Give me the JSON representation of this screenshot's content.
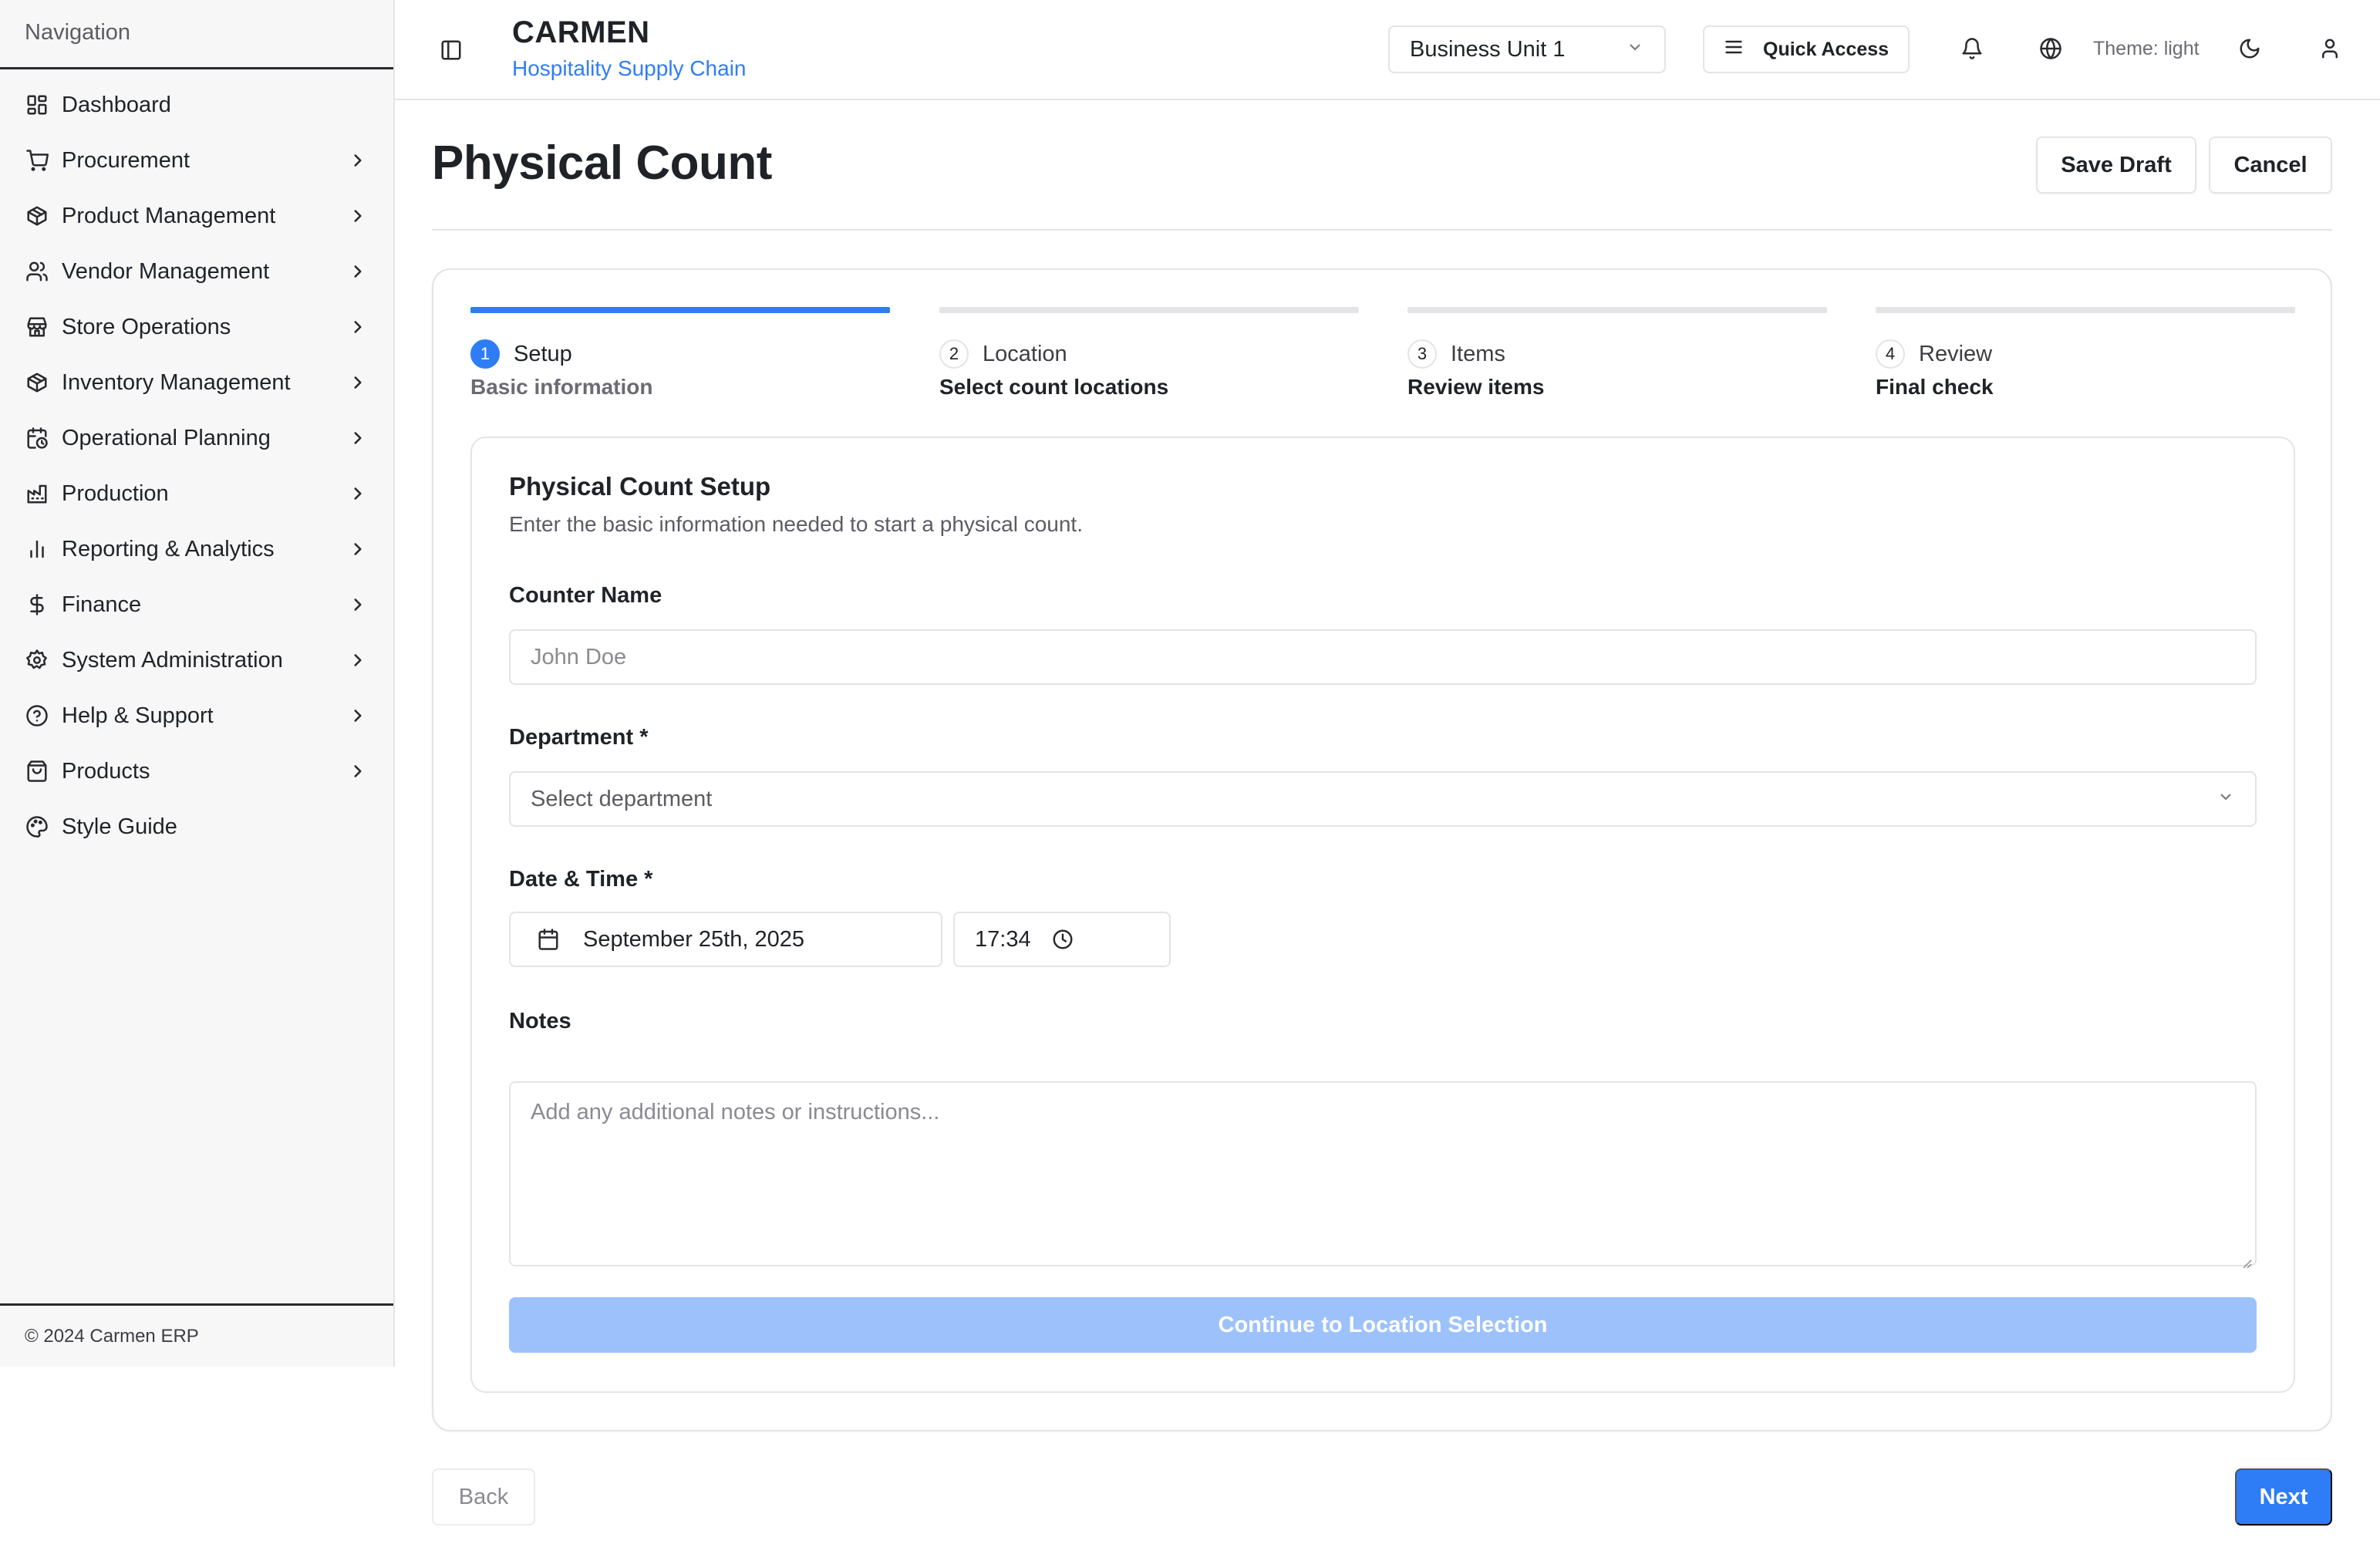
{
  "sidebar": {
    "heading": "Navigation",
    "items": [
      {
        "label": "Dashboard",
        "icon": "dashboard-icon",
        "has_children": false
      },
      {
        "label": "Procurement",
        "icon": "cart-icon",
        "has_children": true
      },
      {
        "label": "Product Management",
        "icon": "package-icon",
        "has_children": true
      },
      {
        "label": "Vendor Management",
        "icon": "users-icon",
        "has_children": true
      },
      {
        "label": "Store Operations",
        "icon": "store-icon",
        "has_children": true
      },
      {
        "label": "Inventory Management",
        "icon": "package-icon",
        "has_children": true
      },
      {
        "label": "Operational Planning",
        "icon": "calendar-clock-icon",
        "has_children": true
      },
      {
        "label": "Production",
        "icon": "factory-icon",
        "has_children": true
      },
      {
        "label": "Reporting & Analytics",
        "icon": "bar-chart-icon",
        "has_children": true
      },
      {
        "label": "Finance",
        "icon": "dollar-icon",
        "has_children": true
      },
      {
        "label": "System Administration",
        "icon": "settings-icon",
        "has_children": true
      },
      {
        "label": "Help & Support",
        "icon": "help-circle-icon",
        "has_children": true
      },
      {
        "label": "Products",
        "icon": "shopping-bag-icon",
        "has_children": true
      },
      {
        "label": "Style Guide",
        "icon": "palette-icon",
        "has_children": false
      }
    ],
    "footer": "© 2024 Carmen ERP"
  },
  "header": {
    "brand_name": "CARMEN",
    "brand_subtitle": "Hospitality Supply Chain",
    "business_unit": "Business Unit 1",
    "quick_access_label": "Quick Access",
    "theme_label": "Theme: light"
  },
  "page": {
    "title": "Physical Count",
    "save_draft_label": "Save Draft",
    "cancel_label": "Cancel"
  },
  "steps": [
    {
      "number": "1",
      "title": "Setup",
      "subtitle": "Basic information",
      "active": true
    },
    {
      "number": "2",
      "title": "Location",
      "subtitle": "Select count locations",
      "active": false
    },
    {
      "number": "3",
      "title": "Items",
      "subtitle": "Review items",
      "active": false
    },
    {
      "number": "4",
      "title": "Review",
      "subtitle": "Final check",
      "active": false
    }
  ],
  "form": {
    "title": "Physical Count Setup",
    "description": "Enter the basic information needed to start a physical count.",
    "counter_name_label": "Counter Name",
    "counter_name_placeholder": "John Doe",
    "counter_name_value": "",
    "department_label": "Department *",
    "department_placeholder": "Select department",
    "datetime_label": "Date & Time *",
    "date_value": "September 25th, 2025",
    "time_value": "17:34",
    "notes_label": "Notes",
    "notes_placeholder": "Add any additional notes or instructions...",
    "continue_label": "Continue to Location Selection"
  },
  "footer_nav": {
    "back_label": "Back",
    "next_label": "Next"
  },
  "colors": {
    "accent": "#2f7df6",
    "accent_disabled": "#9dc2fb",
    "brand_subtitle": "#2f7df6"
  }
}
